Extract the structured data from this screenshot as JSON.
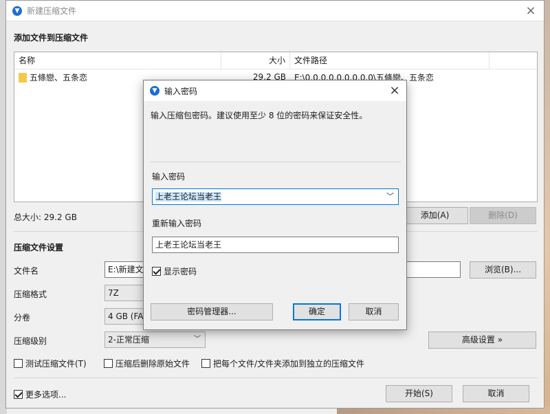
{
  "window": {
    "title": "新建压缩文件",
    "close_glyph": "×",
    "icon": "app-logo-icon"
  },
  "section_add_title": "添加文件到压缩文件",
  "file_list": {
    "columns": [
      "名称",
      "大小",
      "文件路径"
    ],
    "rows": [
      {
        "name": "五條戀、五条恋",
        "size": "29.2 GB",
        "path": "E:\\0.0.0.0.0.0.0.0.0\\五條戀、五条恋"
      }
    ]
  },
  "total_size": "总大小: 29.2 GB",
  "buttons": {
    "add": "添加(A)",
    "delete": "删除(D)",
    "browse": "浏览(B)...",
    "advanced": "高级设置 »",
    "start": "开始(S)",
    "cancel": "取消"
  },
  "settings": {
    "title": "压缩文件设置",
    "filename_label": "文件名",
    "filename_value": "E:\\新建文件",
    "format_label": "压缩格式",
    "format_value": "7Z",
    "volume_label": "分卷",
    "volume_value": "4 GB (FAT",
    "level_label": "压缩级别",
    "level_value": "2-正常压缩"
  },
  "checkboxes": {
    "test": "测试压缩文件(T)",
    "delete_after": "压缩后删除原始文件",
    "separate": "把每个文件/文件夹添加到独立的压缩文件",
    "more_options": "更多选项..."
  },
  "dialog": {
    "title": "输入密码",
    "close_glyph": "×",
    "description": "输入压缩包密码。建议使用至少 8 位的密码来保证安全性。",
    "password_label": "输入密码",
    "password_value": "上老王论坛当老王",
    "reenter_label": "重新输入密码",
    "reenter_value": "上老王论坛当老王",
    "show_password": "显示密码",
    "manager_button": "密码管理器...",
    "ok_button": "确定",
    "cancel_button": "取消"
  },
  "colors": {
    "accent": "#0078d7",
    "selection": "#cce8ff",
    "app_icon": "#1b6fd4",
    "folder": "#f5c84c"
  }
}
